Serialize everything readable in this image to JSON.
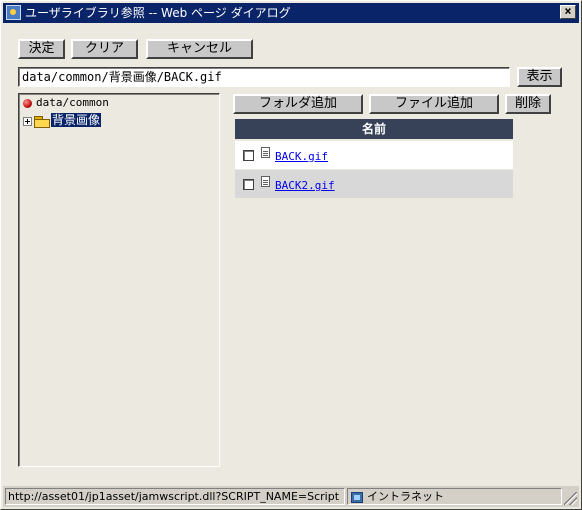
{
  "window": {
    "title": "ユーザライブラリ参照 -- Web ページ ダイアログ",
    "close_glyph": "×"
  },
  "toolbar": {
    "ok_label": "決定",
    "clear_label": "クリア",
    "cancel_label": "キャンセル"
  },
  "path": {
    "value": "data/common/背景画像/BACK.gif",
    "show_label": "表示"
  },
  "tree": {
    "root_label": "data/common",
    "folder_label": "背景画像"
  },
  "actions": {
    "add_folder_label": "フォルダ追加",
    "add_file_label": "ファイル追加",
    "delete_label": "削除"
  },
  "table": {
    "header": "名前",
    "rows": [
      {
        "name": "BACK.gif"
      },
      {
        "name": "BACK2.gif"
      }
    ]
  },
  "status": {
    "url": "http://asset01/jp1asset/jamwscript.dll?SCRIPT_NAME=Script",
    "zone": "イントラネット"
  }
}
